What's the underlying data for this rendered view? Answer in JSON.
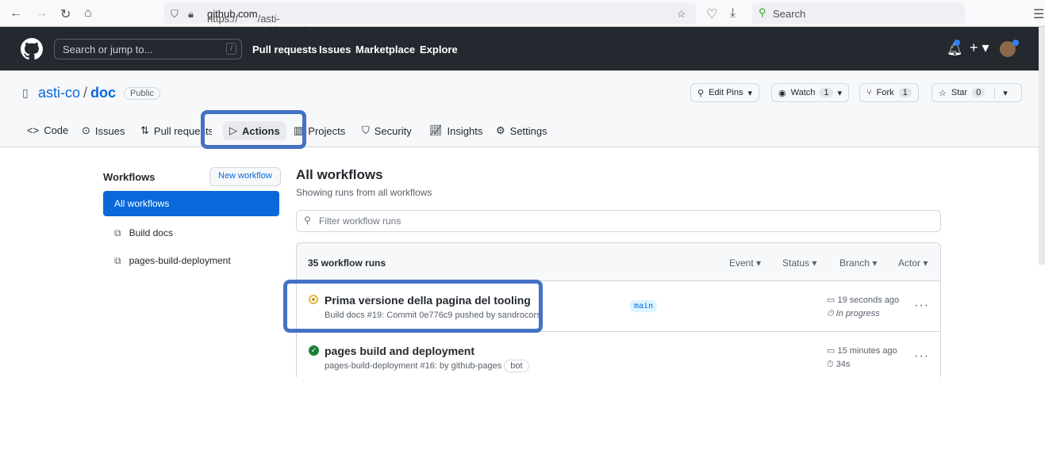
{
  "browser": {
    "url_prefix": "https://",
    "url_domain": "github.com",
    "url_path": "/asti-co/doc/actions",
    "search_placeholder": "Search"
  },
  "header": {
    "search_placeholder": "Search or jump to...",
    "slash": "/",
    "nav": [
      "Pull requests",
      "Issues",
      "Marketplace",
      "Explore"
    ]
  },
  "repo": {
    "owner": "asti-co",
    "sep": "/",
    "name": "doc",
    "visibility": "Public",
    "buttons": {
      "edit_pins": "Edit Pins",
      "watch": "Watch",
      "watch_count": "1",
      "fork": "Fork",
      "fork_count": "1",
      "star": "Star",
      "star_count": "0"
    },
    "tabs": [
      "Code",
      "Issues",
      "Pull requests",
      "Actions",
      "Projects",
      "Security",
      "Insights",
      "Settings"
    ],
    "active_tab": "Actions"
  },
  "sidebar": {
    "title": "Workflows",
    "new_workflow": "New workflow",
    "items": [
      "All workflows",
      "Build docs",
      "pages-build-deployment"
    ]
  },
  "main": {
    "title": "All workflows",
    "subtitle": "Showing runs from all workflows",
    "filter_placeholder": "Filter workflow runs",
    "count": "35 workflow runs",
    "filters": [
      "Event",
      "Status",
      "Branch",
      "Actor"
    ],
    "runs": [
      {
        "status": "in_progress",
        "title": "Prima versione della pagina del tooling",
        "sub": "Build docs #19: Commit 0e776c9 pushed by sandrocorsi",
        "branch": "main",
        "time": "19 seconds ago",
        "duration": "In progress"
      },
      {
        "status": "success",
        "title": "pages build and deployment",
        "sub": "pages-build-deployment #16: by github-pages",
        "badge": "bot",
        "time": "15 minutes ago",
        "duration": "34s"
      }
    ]
  },
  "colors": {
    "header": "#24292f",
    "accent": "#0969da",
    "highlight": "#4472c4",
    "success": "#1a7f37",
    "progress": "#bf8700"
  }
}
